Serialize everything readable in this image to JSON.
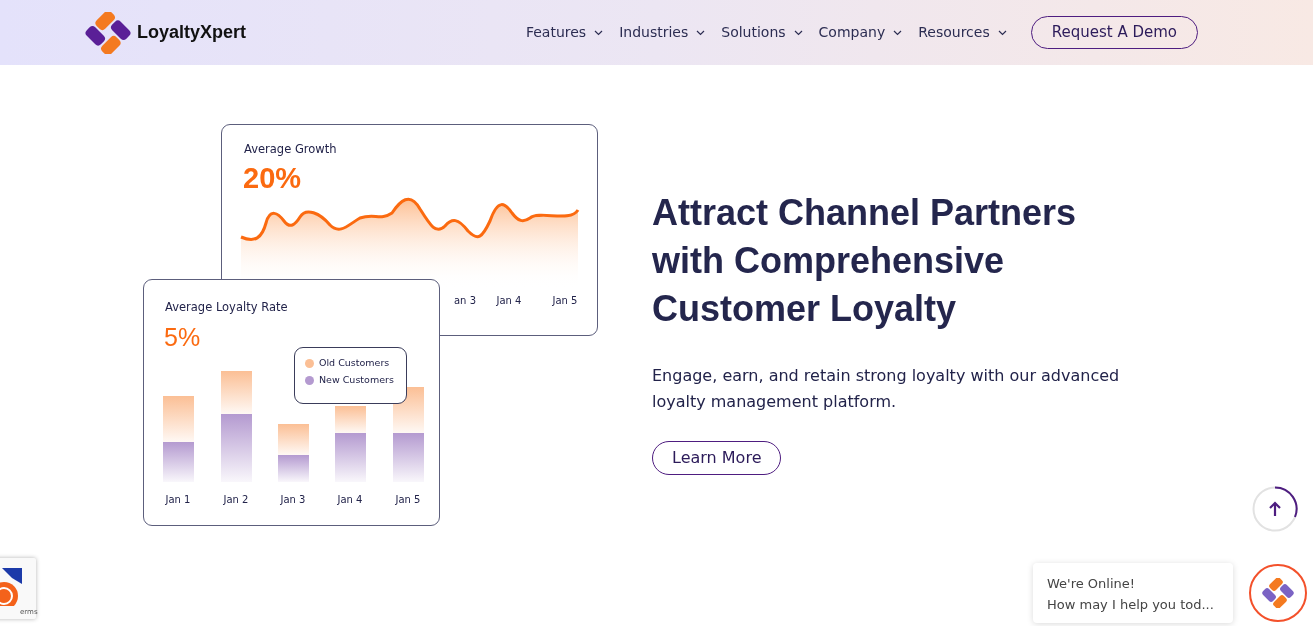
{
  "nav": {
    "brand": "LoyaltyXpert",
    "items": [
      {
        "label": "Features"
      },
      {
        "label": "Industries"
      },
      {
        "label": "Solutions"
      },
      {
        "label": "Company"
      },
      {
        "label": "Resources"
      }
    ],
    "cta": "Request A Demo"
  },
  "growth_card": {
    "title": "Average Growth",
    "value": "20%",
    "x_labels": [
      "an 3",
      "Jan 4",
      "Jan 5"
    ]
  },
  "loyalty_card": {
    "title": "Average Loyalty Rate",
    "value": "5%",
    "x_labels": [
      "Jan 1",
      "Jan 2",
      "Jan 3",
      "Jan 4",
      "Jan 5"
    ],
    "legend": [
      {
        "label": "Old Customers",
        "color": "#fbbf95"
      },
      {
        "label": "New Customers",
        "color": "#b49ad0"
      }
    ]
  },
  "hero": {
    "heading": "Attract Channel Partners with Comprehensive Customer Loyalty",
    "text": "Engage, earn, and retain strong loyalty with our advanced loyalty management platform.",
    "button": "Learn More"
  },
  "recaptcha": {
    "text": "erms"
  },
  "chat": {
    "title": "We're Online!",
    "message": "How may I help you tod..."
  }
}
